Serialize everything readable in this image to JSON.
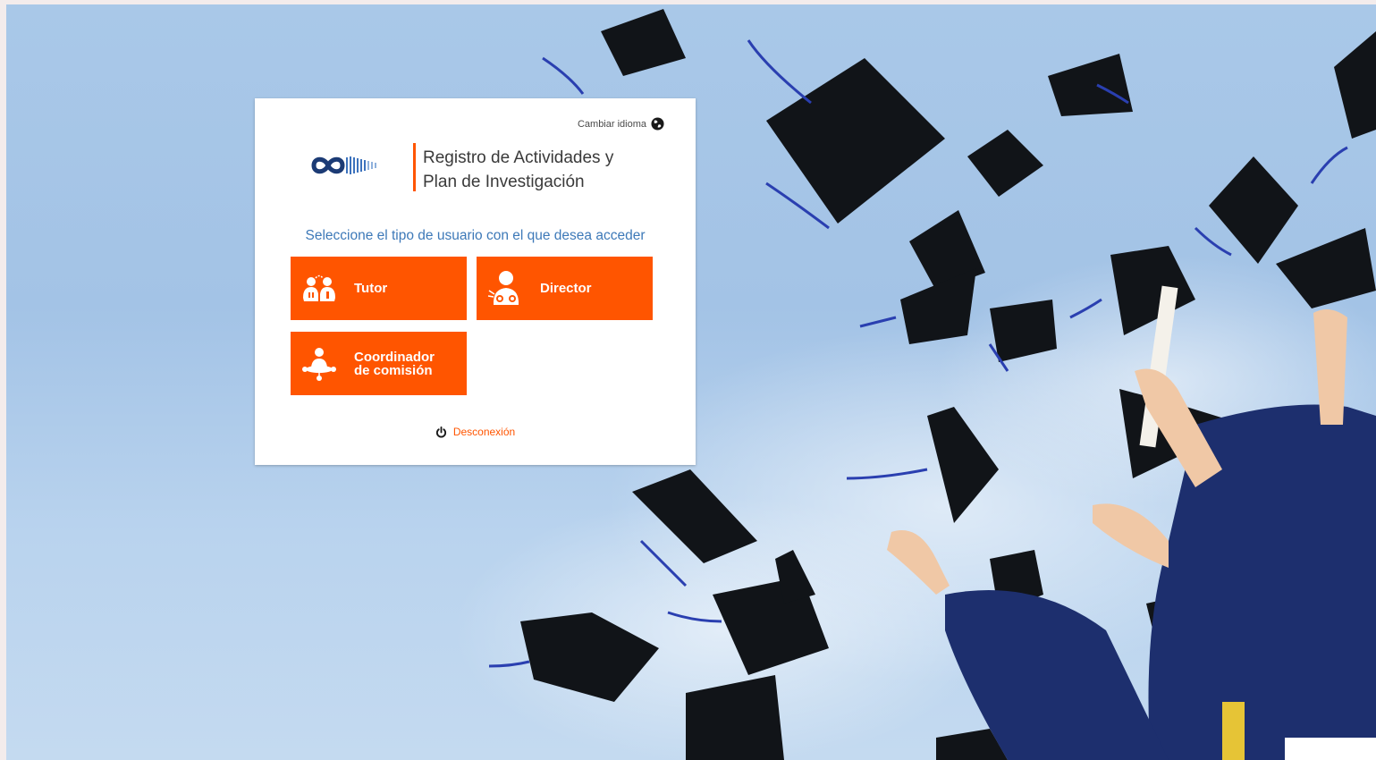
{
  "language": {
    "label": "Cambiar idioma",
    "icon": "globe-icon"
  },
  "brand": {
    "logo": "infinity-logo",
    "title_line1": "Registro de Actividades y",
    "title_line2": "Plan de Investigación",
    "accent_color": "#ff5500"
  },
  "prompt": "Seleccione el tipo de usuario con el que desea acceder",
  "roles": [
    {
      "line1": "Tutor",
      "line2": "",
      "icon": "tutor-icon"
    },
    {
      "line1": "Director",
      "line2": "",
      "icon": "director-icon"
    },
    {
      "line1": "Coordinador",
      "line2": "de comisión",
      "icon": "coordinator-icon"
    }
  ],
  "logout": {
    "label": "Desconexión",
    "icon": "power-icon"
  },
  "background": "graduation-caps-photo",
  "colors": {
    "tile": "#ff5500",
    "prompt": "#3d79b8",
    "sky": "#a9c8e8"
  }
}
